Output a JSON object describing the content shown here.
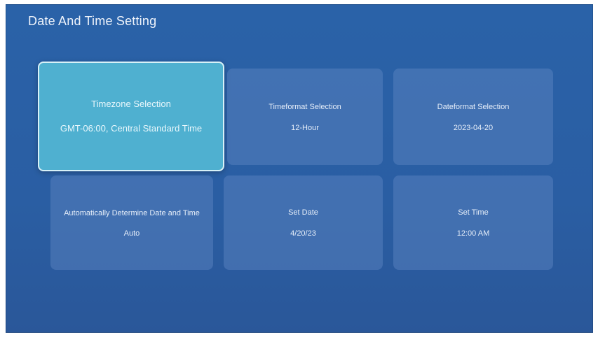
{
  "page": {
    "title": "Date And Time Setting"
  },
  "tiles": [
    {
      "label": "Timezone Selection",
      "value": "GMT-06:00, Central Standard Time",
      "selected": true
    },
    {
      "label": "Timeformat Selection",
      "value": "12-Hour",
      "selected": false
    },
    {
      "label": "Dateformat Selection",
      "value": "2023-04-20",
      "selected": false
    },
    {
      "label": "Automatically Determine Date and Time",
      "value": "Auto",
      "selected": false
    },
    {
      "label": "Set Date",
      "value": "4/20/23",
      "selected": false
    },
    {
      "label": "Set Time",
      "value": "12:00 AM",
      "selected": false
    }
  ],
  "colors": {
    "background": "#2a62a8",
    "tile": "#4a78b8",
    "selected_tile": "#4fb0d0",
    "text": "#e6eef9"
  }
}
